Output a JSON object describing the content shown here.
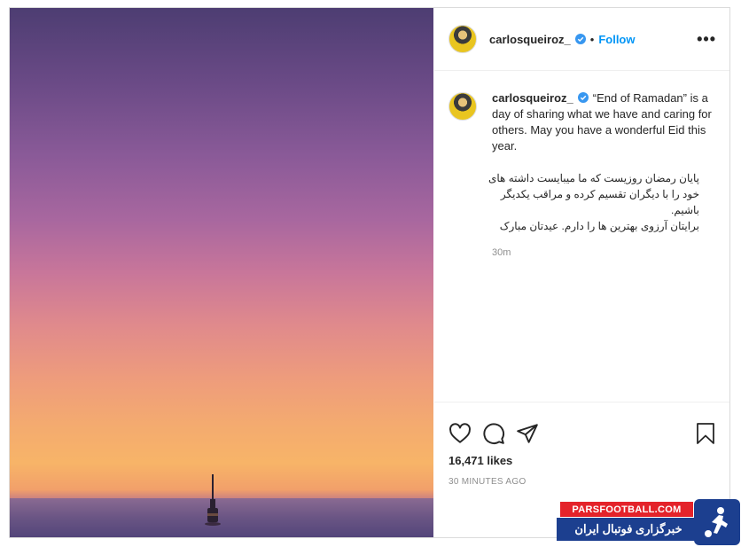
{
  "post": {
    "username": "carlosqueiroz_",
    "separator": "•",
    "follow_label": "Follow",
    "more_label": "•••",
    "caption_en": "“End of Ramadan” is a day of sharing what we have and caring for others. May you have a wonderful Eid this year.",
    "caption_fa": "پایان رمضان روزیست که ما میبایست داشته های\nخود را با دیگران تقسیم کرده و مراقب یکدیگر باشیم.\nبرایتان آرزوی بهترین ها را دارم. عیدتان مبارک",
    "comment_time": "30m",
    "likes": "16,471 likes",
    "posted_ago": "30 MINUTES AGO"
  },
  "icons": {
    "verified": "verified-badge-icon",
    "like": "heart-icon",
    "comment": "comment-icon",
    "share": "paper-plane-icon",
    "save": "bookmark-icon"
  },
  "watermark": {
    "site": "PARSFOOTBALL.COM",
    "tagline": "خبرگزاری فوتبال ایران"
  },
  "colors": {
    "accent": "#0095f6",
    "verified": "#3897f0",
    "watermark_red": "#e4232a",
    "watermark_blue": "#1c3f8f"
  }
}
